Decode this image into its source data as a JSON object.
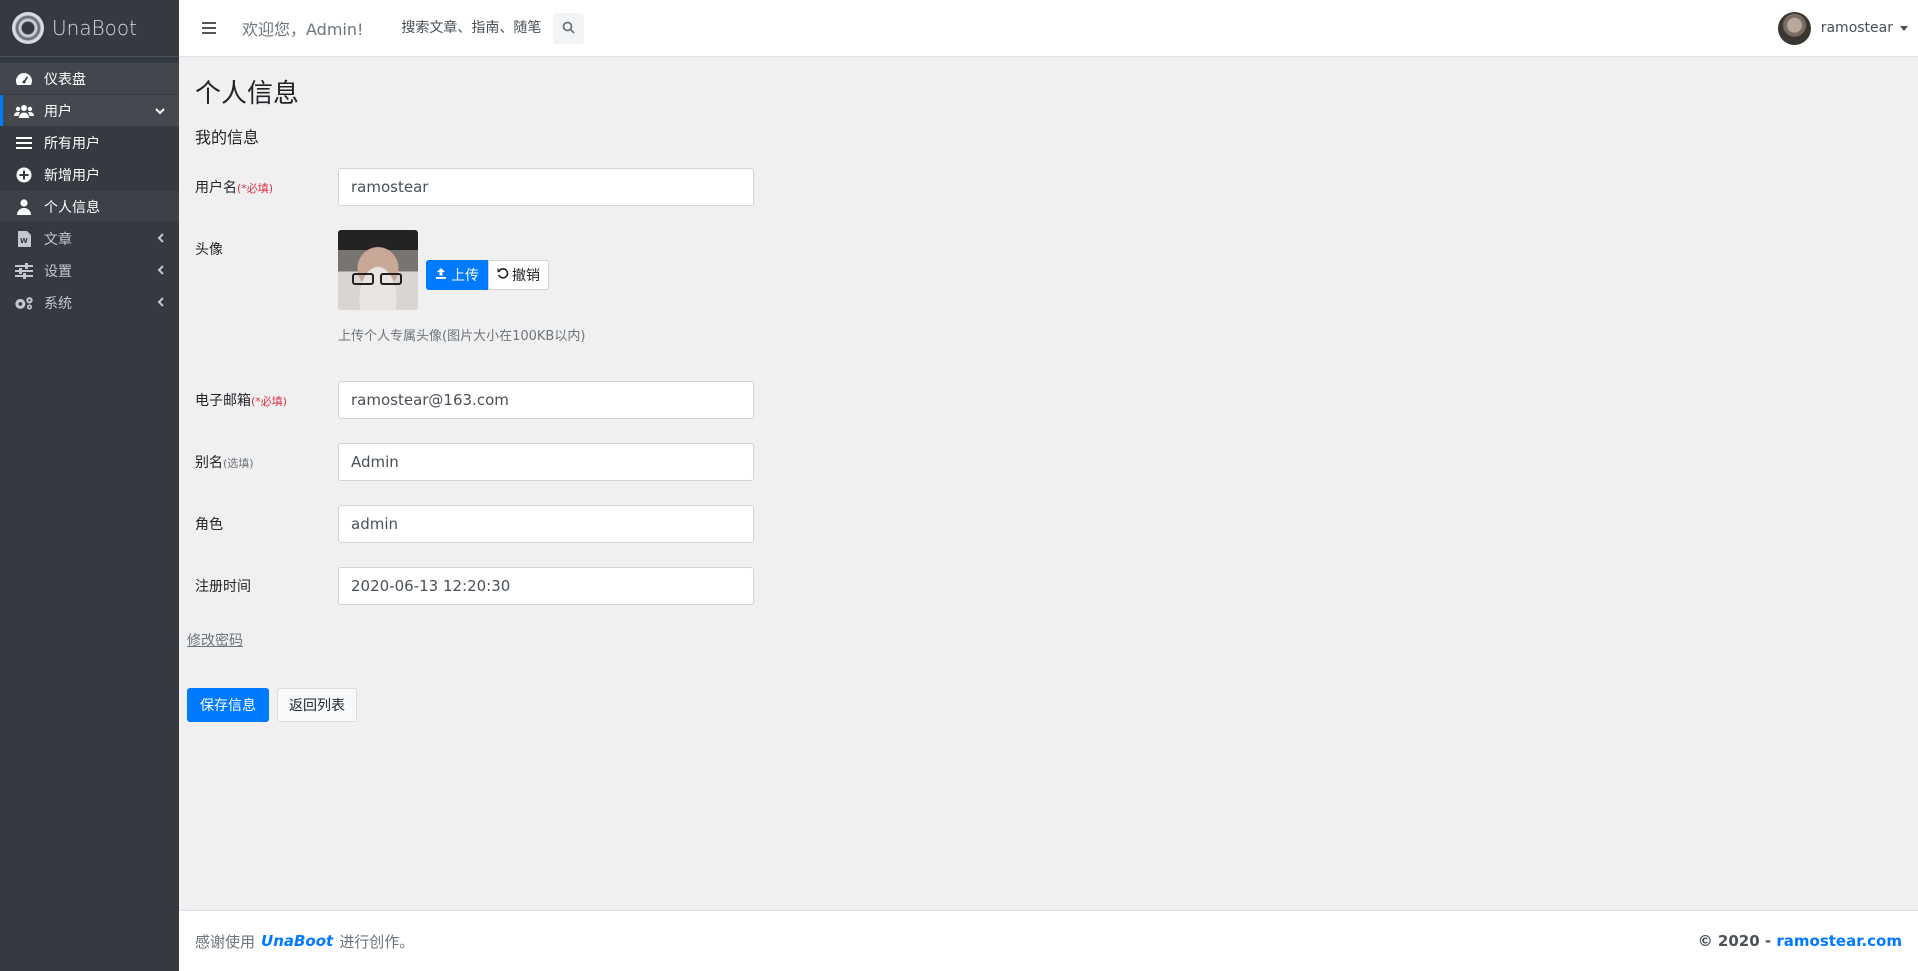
{
  "brand": {
    "name": "UnaBoot"
  },
  "sidebar": {
    "items": [
      {
        "label": "仪表盘",
        "icon": "dashboard-icon"
      },
      {
        "label": "用户",
        "icon": "users-icon"
      },
      {
        "label": "所有用户",
        "icon": "list-icon"
      },
      {
        "label": "新增用户",
        "icon": "plus-circle-icon"
      },
      {
        "label": "个人信息",
        "icon": "user-icon"
      },
      {
        "label": "文章",
        "icon": "document-icon"
      },
      {
        "label": "设置",
        "icon": "sliders-icon"
      },
      {
        "label": "系统",
        "icon": "cogs-icon"
      }
    ]
  },
  "header": {
    "welcome": "欢迎您，Admin!",
    "search_placeholder": "搜索文章、指南、随笔",
    "user_name": "ramostear"
  },
  "main": {
    "page_title": "个人信息",
    "section_title": "我的信息",
    "fields": {
      "username": {
        "label": "用户名",
        "hint": "(*必填)",
        "value": "ramostear"
      },
      "avatar": {
        "label": "头像",
        "upload_label": "上传",
        "cancel_label": "撤销",
        "help": "上传个人专属头像(图片大小在100KB以内)"
      },
      "email": {
        "label": "电子邮箱",
        "hint": "(*必填)",
        "value": "ramostear@163.com"
      },
      "alias": {
        "label": "别名",
        "hint": "(选填)",
        "value": "Admin"
      },
      "role": {
        "label": "角色",
        "value": "admin"
      },
      "registered": {
        "label": "注册时间",
        "value": "2020-06-13 12:20:30"
      }
    },
    "change_password": "修改密码",
    "save_label": "保存信息",
    "back_label": "返回列表"
  },
  "footer": {
    "left_prefix": "感谢使用",
    "brand": "UnaBoot",
    "left_suffix": "进行创作。",
    "copyright": "© 2020 -",
    "site": "ramostear.com"
  },
  "colors": {
    "sidebar_bg": "#343a40",
    "primary": "#007bff",
    "required": "#dc3545"
  }
}
